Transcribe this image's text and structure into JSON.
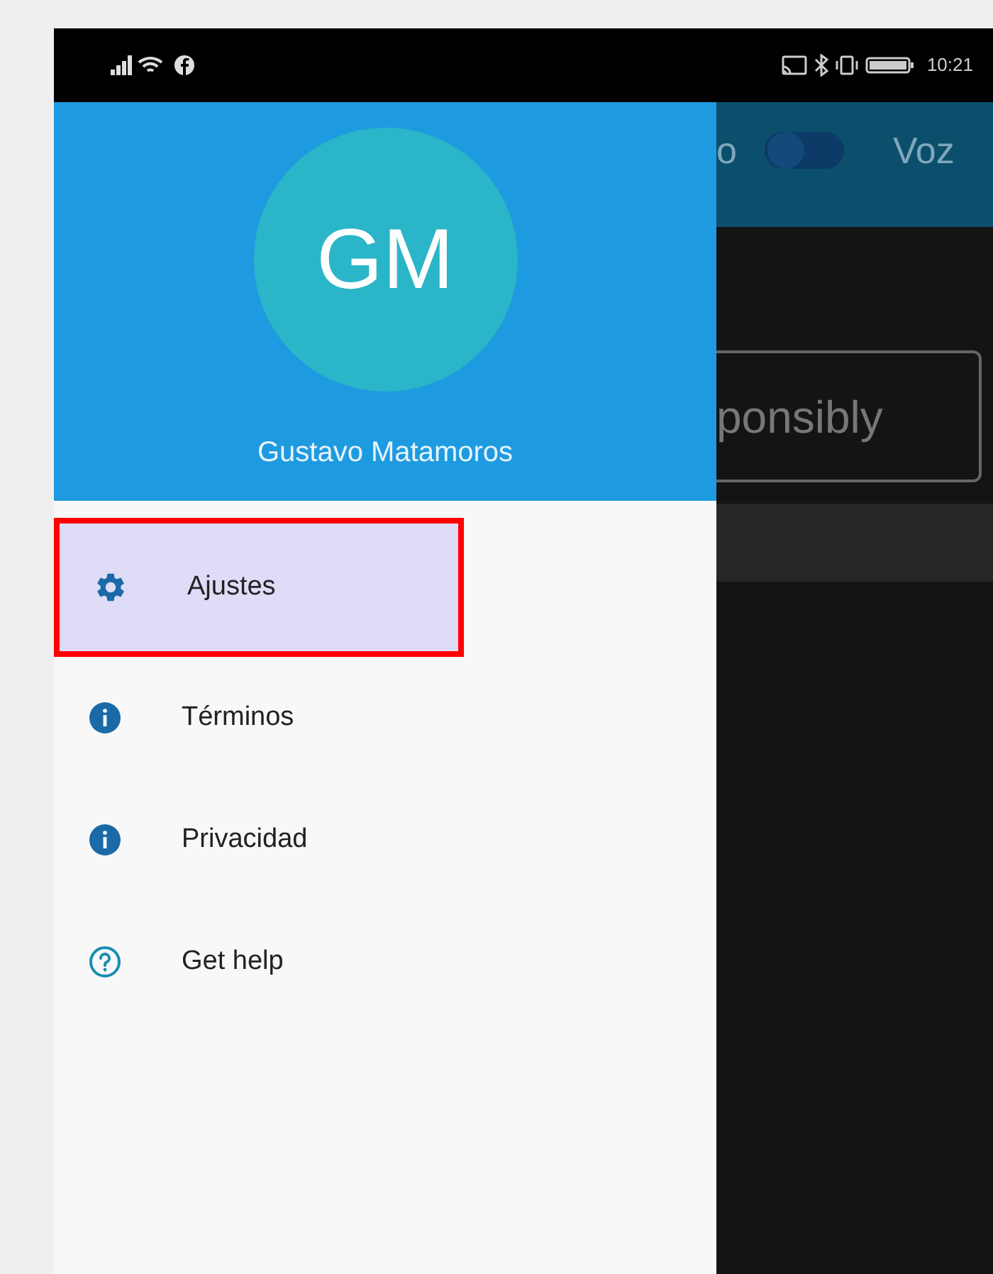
{
  "status_bar": {
    "time": "10:21"
  },
  "drawer": {
    "avatar_initials": "GM",
    "user_name": "Gustavo Matamoros",
    "items": [
      {
        "label": "Ajustes",
        "kind": "settings",
        "selected": true,
        "outlined": true
      },
      {
        "label": "Términos",
        "kind": "info",
        "selected": false,
        "outlined": false
      },
      {
        "label": "Privacidad",
        "kind": "info",
        "selected": false,
        "outlined": false
      },
      {
        "label": "Get help",
        "kind": "help",
        "selected": false,
        "outlined": false
      }
    ]
  },
  "background_app": {
    "tab_label": "o",
    "toggle": {
      "on": false
    },
    "toggle_label": "Voz",
    "button_label": "ponsibly"
  }
}
